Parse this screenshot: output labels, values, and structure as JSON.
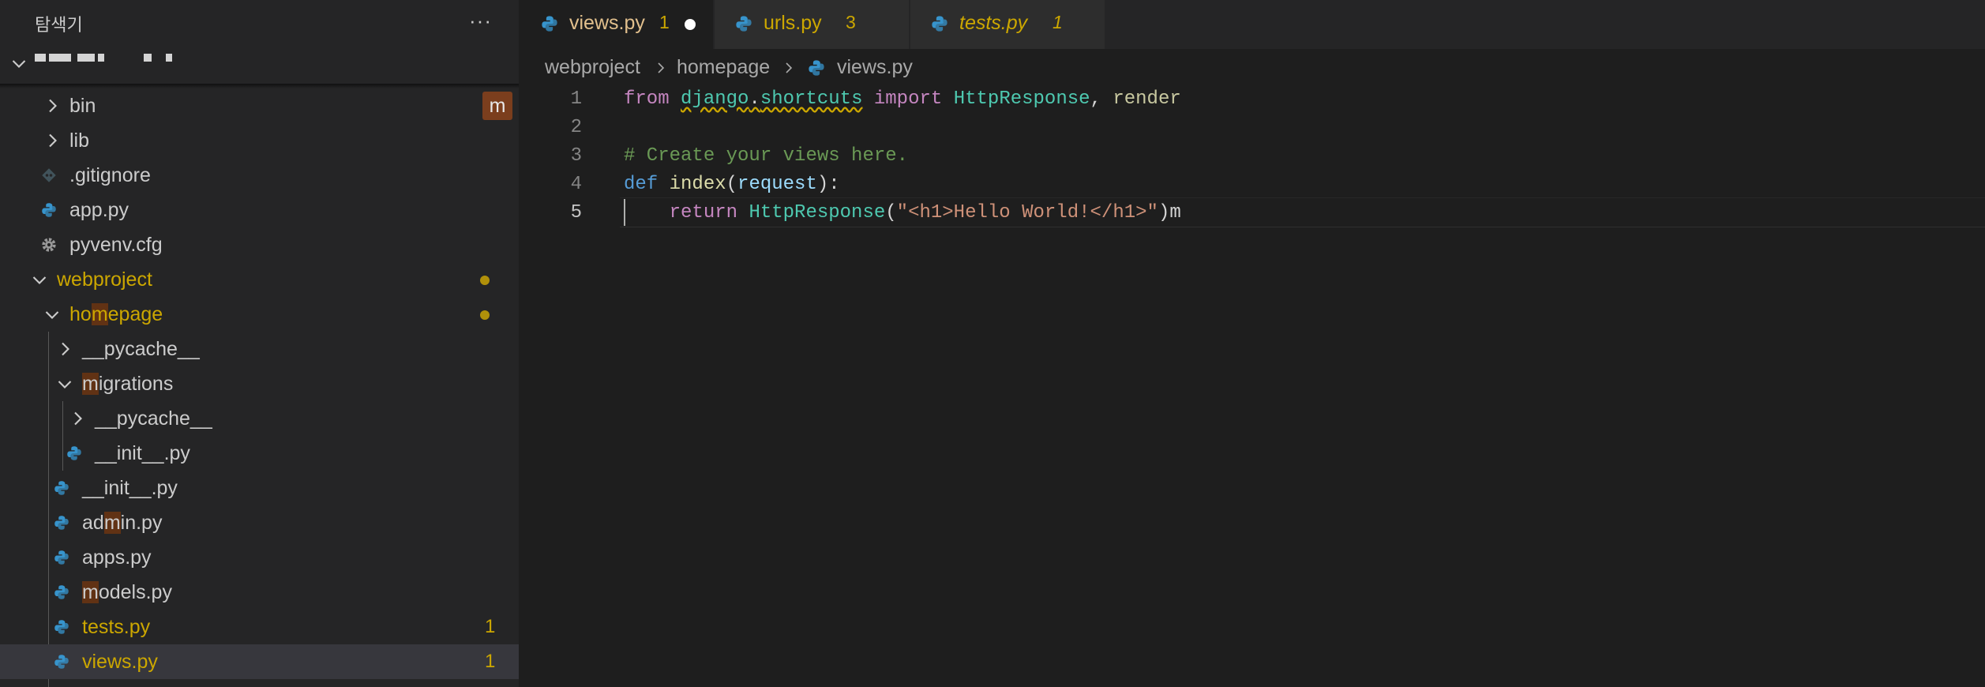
{
  "sidebar": {
    "title": "탐색기",
    "more_label": "···",
    "rows": [
      {
        "label": "bin",
        "badge": "m"
      },
      {
        "label": "lib"
      },
      {
        "label": ".gitignore"
      },
      {
        "label": "app.py"
      },
      {
        "label": "pyvenv.cfg"
      },
      {
        "label": "webproject"
      },
      {
        "pre": "ho",
        "hl": "m",
        "post": "epage"
      },
      {
        "label": "__pycache__"
      },
      {
        "pre": "",
        "hl": "m",
        "post": "igrations"
      },
      {
        "label": "__pycache__"
      },
      {
        "label": "__init__.py"
      },
      {
        "label": "__init__.py"
      },
      {
        "pre": "ad",
        "hl": "m",
        "post": "in.py"
      },
      {
        "label": "apps.py"
      },
      {
        "pre": "",
        "hl": "m",
        "post": "odels.py"
      },
      {
        "label": "tests.py",
        "count": "1"
      },
      {
        "label": "views.py",
        "count": "1"
      }
    ]
  },
  "tabs": [
    {
      "label": "views.py",
      "count": "1"
    },
    {
      "label": "urls.py",
      "count": "3"
    },
    {
      "label": "tests.py",
      "count": "1"
    }
  ],
  "breadcrumb": [
    "webproject",
    "homepage",
    "views.py"
  ],
  "code": {
    "line_numbers": [
      "1",
      "2",
      "3",
      "4",
      "5"
    ],
    "l1": [
      "from",
      "django",
      ".",
      "shortcuts",
      "import",
      "HttpResponse",
      ",",
      "render"
    ],
    "l3": "# Create your views here.",
    "l4": [
      "def",
      "index",
      "(",
      "request",
      "):"
    ],
    "l5": [
      "return",
      "HttpResponse",
      "(",
      "\"<h1>Hello World!</h1>\"",
      ")m"
    ]
  }
}
